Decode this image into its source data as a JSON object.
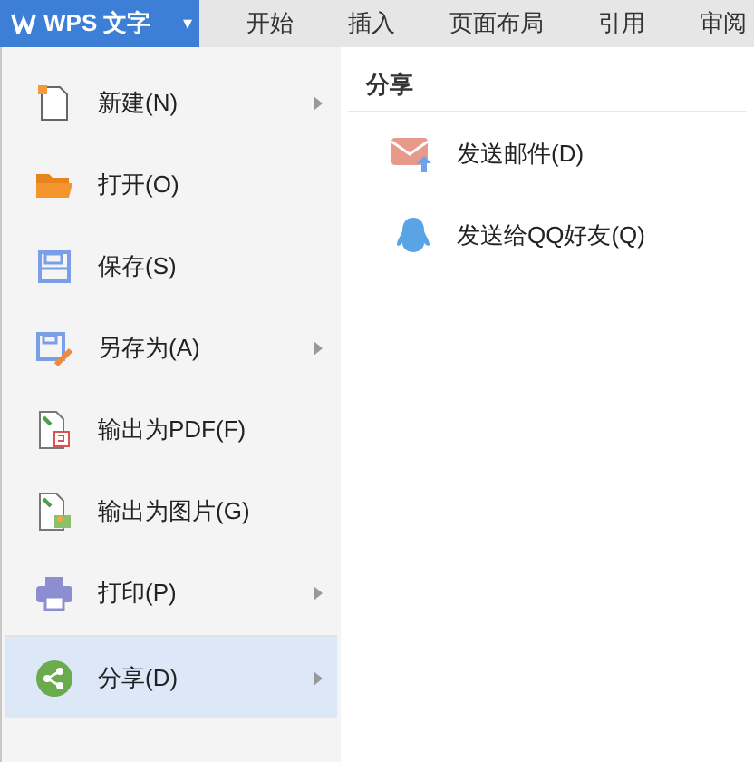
{
  "app_button": {
    "label": "WPS 文字",
    "caret": "▾"
  },
  "tabs": [
    {
      "label": "开始"
    },
    {
      "label": "插入"
    },
    {
      "label": "页面布局"
    },
    {
      "label": "引用"
    },
    {
      "label": "审阅"
    }
  ],
  "menu": [
    {
      "kind": "new",
      "label": "新建(N)",
      "submenu": true,
      "selected": false
    },
    {
      "kind": "open",
      "label": "打开(O)",
      "submenu": false,
      "selected": false
    },
    {
      "kind": "save",
      "label": "保存(S)",
      "submenu": false,
      "selected": false
    },
    {
      "kind": "saveas",
      "label": "另存为(A)",
      "submenu": true,
      "selected": false
    },
    {
      "kind": "pdf",
      "label": "输出为PDF(F)",
      "submenu": false,
      "selected": false
    },
    {
      "kind": "image",
      "label": "输出为图片(G)",
      "submenu": false,
      "selected": false
    },
    {
      "kind": "print",
      "label": "打印(P)",
      "submenu": true,
      "selected": false
    },
    {
      "kind": "share",
      "label": "分享(D)",
      "submenu": true,
      "selected": true
    }
  ],
  "panel": {
    "title": "分享",
    "items": [
      {
        "kind": "mail",
        "label": "发送邮件(D)"
      },
      {
        "kind": "qq",
        "label": "发送给QQ好友(Q)"
      }
    ]
  }
}
